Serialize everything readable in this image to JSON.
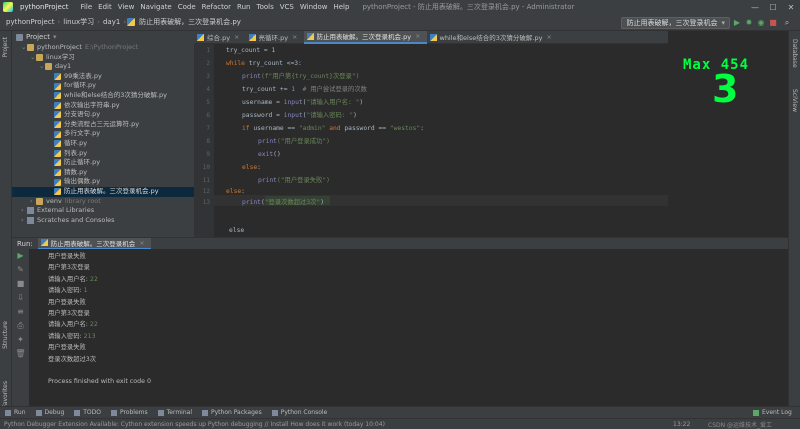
{
  "menubar": {
    "project": "pythonProject",
    "items": [
      "File",
      "Edit",
      "View",
      "Navigate",
      "Code",
      "Refactor",
      "Run",
      "Tools",
      "VCS",
      "Window",
      "Help"
    ],
    "window_title": "pythonProject - 防止用表破解。三次登录机会.py - Administrator"
  },
  "navbar": {
    "crumbs": [
      "pythonProject",
      "linux学习",
      "day1",
      "防止用表破解，三次登录机会.py"
    ],
    "run_config": "防止用表破解，三次登录机会"
  },
  "project": {
    "header": "Project",
    "items": [
      {
        "label": "pythonProject",
        "suffix": "E:\\PythonProject",
        "type": "folder",
        "indent": 1
      },
      {
        "label": "linux学习",
        "suffix": "",
        "type": "folder",
        "indent": 2
      },
      {
        "label": "day1",
        "suffix": "",
        "type": "folder",
        "indent": 3
      },
      {
        "label": "99乘法表.py",
        "suffix": "",
        "type": "py",
        "indent": 4
      },
      {
        "label": "for循环.py",
        "suffix": "",
        "type": "py",
        "indent": 4
      },
      {
        "label": "while和else结合的3次猜分破解.py",
        "suffix": "",
        "type": "py",
        "indent": 4
      },
      {
        "label": "依次输出字符串.py",
        "suffix": "",
        "type": "py",
        "indent": 4
      },
      {
        "label": "分支语句.py",
        "suffix": "",
        "type": "py",
        "indent": 4
      },
      {
        "label": "分类流程占三元运算符.py",
        "suffix": "",
        "type": "py",
        "indent": 4
      },
      {
        "label": "多行文字.py",
        "suffix": "",
        "type": "py",
        "indent": 4
      },
      {
        "label": "循环.py",
        "suffix": "",
        "type": "py",
        "indent": 4
      },
      {
        "label": "列表.py",
        "suffix": "",
        "type": "py",
        "indent": 4
      },
      {
        "label": "防止循环.py",
        "suffix": "",
        "type": "py",
        "indent": 4
      },
      {
        "label": "猜数.py",
        "suffix": "",
        "type": "py",
        "indent": 4
      },
      {
        "label": "输出偶数.py",
        "suffix": "",
        "type": "py",
        "indent": 4
      },
      {
        "label": "防止用表破解。三次登录机会.py",
        "suffix": "",
        "type": "py",
        "indent": 4,
        "selected": true
      },
      {
        "label": "venv",
        "suffix": "library root",
        "type": "folder",
        "indent": 2
      },
      {
        "label": "External Libraries",
        "suffix": "",
        "type": "lib",
        "indent": 1
      },
      {
        "label": "Scratches and Consoles",
        "suffix": "",
        "type": "lib",
        "indent": 1
      }
    ]
  },
  "tabs": [
    {
      "label": "综合.py",
      "active": false
    },
    {
      "label": "亮循环.py",
      "active": false
    },
    {
      "label": "防止用表破解。三次登录机会.py",
      "active": true
    },
    {
      "label": "while和else结合的3次猜分破解.py",
      "active": false
    }
  ],
  "editor": {
    "lines": [
      "1",
      "2",
      "3",
      "4",
      "5",
      "6",
      "7",
      "8",
      "9",
      "10",
      "11",
      "12",
      "13"
    ],
    "code": {
      "l1": "try_count = 1",
      "l2a": "while ",
      "l2b": "try_count <=3:",
      "l3a": "print",
      "l3b": "(f\"用户第{try_count}次登录\")",
      "l4a": "try_count += ",
      "l4b": "1",
      "l4c": "  # 用户尝试登录的次数",
      "l5a": "username = ",
      "l5b": "input",
      "l5c": "(",
      "l5d": "\"请输入用户名: \"",
      "l5e": ")",
      "l6a": "password = ",
      "l6b": "input",
      "l6c": "(",
      "l6d": "\"请输入密码: \"",
      "l6e": ")",
      "l7a": "if ",
      "l7b": "username == ",
      "l7c": "\"admin\"",
      "l7d": " and ",
      "l7e": "password == ",
      "l7f": "\"westos\"",
      "l7g": ":",
      "l8a": "print",
      "l8b": "(\"用户登录成功\")",
      "l9a": "exit",
      "l9b": "()",
      "l10a": "else",
      "l10b": ":",
      "l11a": "print",
      "l11b": "(\"用户登录失败\")",
      "l12a": "else",
      "l12b": ":",
      "l13a": "print",
      "l13b": "(",
      "l13c": "\"登录次数超过3次\"",
      "l13d": ")",
      "footer": "else"
    }
  },
  "game_overlay": {
    "max_label": "Max 454",
    "score": "3"
  },
  "run": {
    "label": "Run:",
    "tab": "防止用表破解。三次登录机会",
    "console": [
      {
        "text": "用户登录失败",
        "input": ""
      },
      {
        "text": "用户第3次登录",
        "input": ""
      },
      {
        "text": "请输入用户名: ",
        "input": "22"
      },
      {
        "text": "请输入密码: ",
        "input": "1"
      },
      {
        "text": "用户登录失败",
        "input": ""
      },
      {
        "text": "用户第3次登录",
        "input": ""
      },
      {
        "text": "请输入用户名: ",
        "input": "22"
      },
      {
        "text": "请输入密码: ",
        "input": "213"
      },
      {
        "text": "用户登录失败",
        "input": ""
      },
      {
        "text": "登录次数超过3次",
        "input": ""
      },
      {
        "text": "",
        "input": ""
      },
      {
        "text": "Process finished with exit code 0",
        "input": ""
      }
    ]
  },
  "leftstrip": {
    "project": "Project",
    "structure": "Structure",
    "favorites": "Favorites"
  },
  "rightstrip": {
    "database": "Database",
    "sciview": "SciView"
  },
  "bottombar": {
    "items": [
      "Run",
      "Debug",
      "TODO",
      "Problems",
      "Terminal",
      "Python Packages",
      "Python Console"
    ],
    "event_log": "Event Log"
  },
  "status": {
    "message": "Python Debugger Extension Available: Cython extension speeds up Python debugging // Install  How does it work (today 10:04)",
    "position": "13:22",
    "watermark": "CSDN @运维技术_爱工"
  }
}
